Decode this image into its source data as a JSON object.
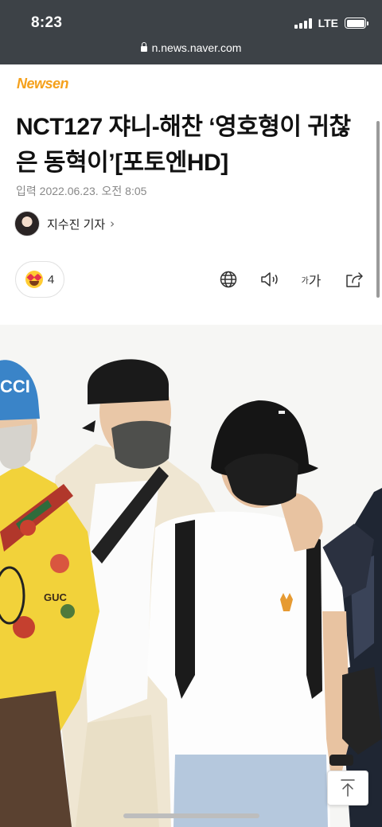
{
  "status": {
    "time": "8:23",
    "network": "LTE",
    "battery_level": 1.0
  },
  "browser": {
    "url": "n.news.naver.com"
  },
  "article": {
    "brand": "Newsen",
    "title": "NCT127 쟈니-해찬 ‘영호형이 귀찮은 동혁이’[포토엔HD]",
    "date_label": "입력",
    "date": "2022.06.23. 오전 8:05",
    "reporter": "지수진 기자",
    "reporter_chevron": "›"
  },
  "reaction": {
    "emoji": "heart-eyes-face",
    "count": "4"
  },
  "tools": {
    "font_small": "가",
    "font_large": "가",
    "icons": [
      "globe-icon",
      "speaker-icon",
      "font-size-icon",
      "share-icon"
    ]
  },
  "photo": {
    "print_text_left": "GUC",
    "hat_logo": "CCI"
  },
  "colors": {
    "status_bar": "#3d4247",
    "brand": "#f5a11c",
    "shirt_print": "#f2d23a"
  }
}
